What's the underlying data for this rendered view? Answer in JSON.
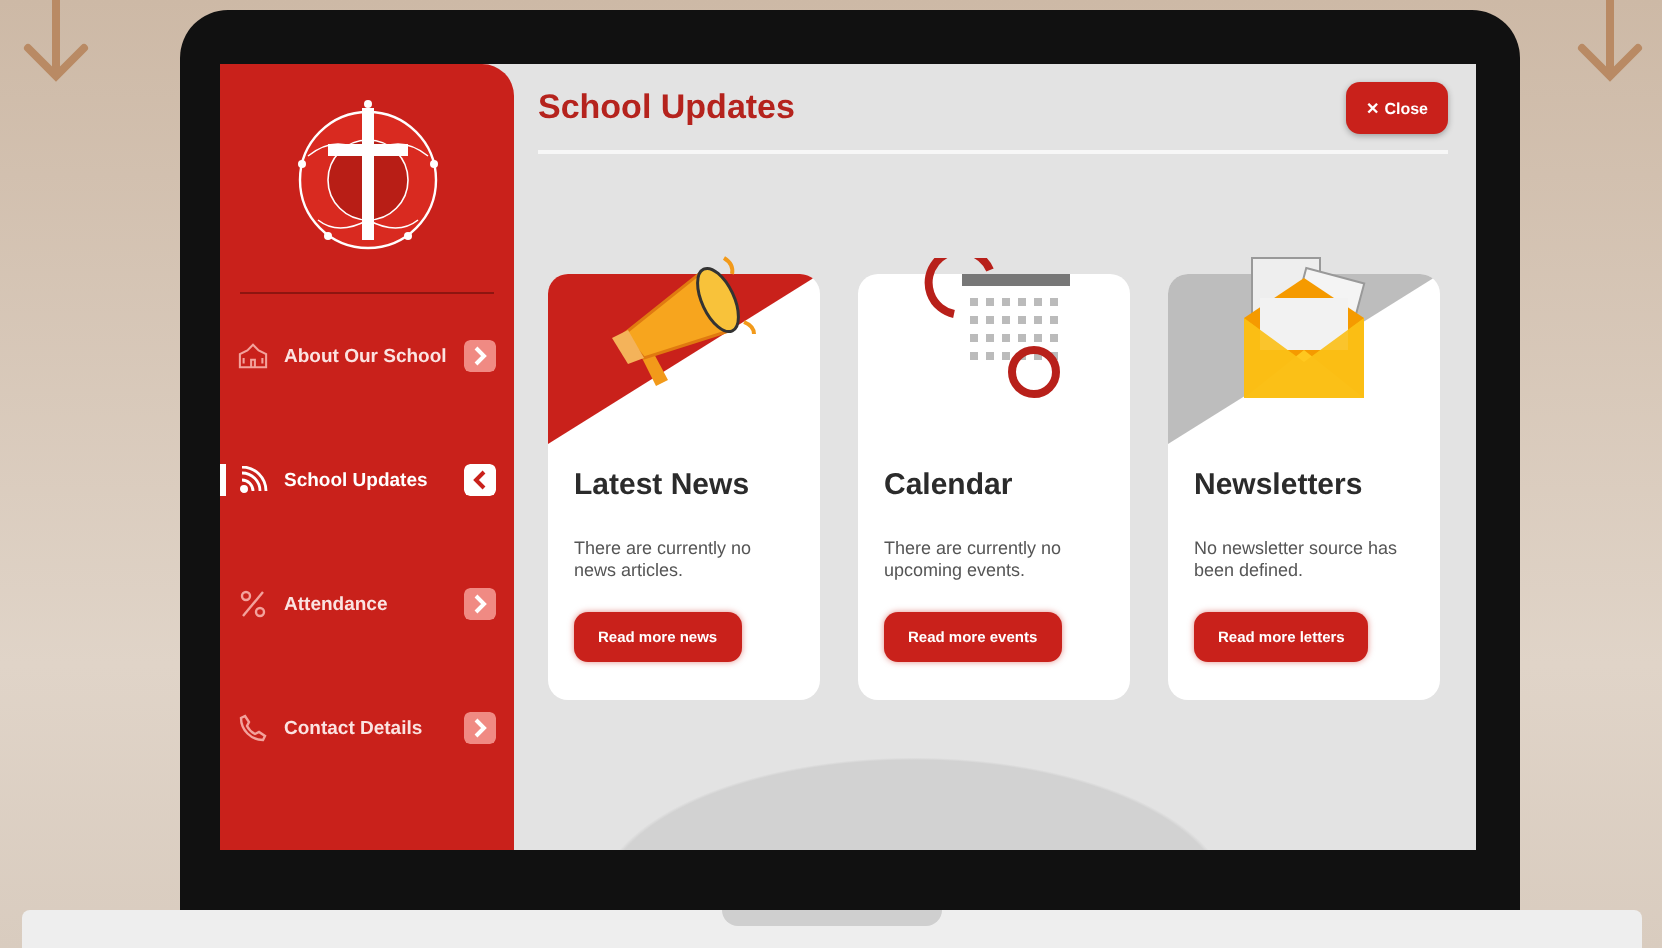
{
  "sidebar": {
    "items": [
      {
        "label": "About Our School",
        "kind": "building",
        "selected": false
      },
      {
        "label": "School Updates",
        "kind": "feed",
        "selected": true
      },
      {
        "label": "Attendance",
        "kind": "percent",
        "selected": false
      },
      {
        "label": "Contact Details",
        "kind": "phone",
        "selected": false
      }
    ]
  },
  "header": {
    "title": "School Updates",
    "close_button": "Close",
    "close_glyph": "✕"
  },
  "cards": [
    {
      "kind": "megaphone",
      "title": "Latest News",
      "text": "There are currently no news articles.",
      "button": "Read more news"
    },
    {
      "kind": "calendar",
      "title": "Calendar",
      "text": "There are currently no upcoming events.",
      "button": "Read more events"
    },
    {
      "kind": "envelope",
      "title": "Newsletters",
      "text": "No newsletter source has been defined.",
      "button": "Read more letters"
    }
  ]
}
